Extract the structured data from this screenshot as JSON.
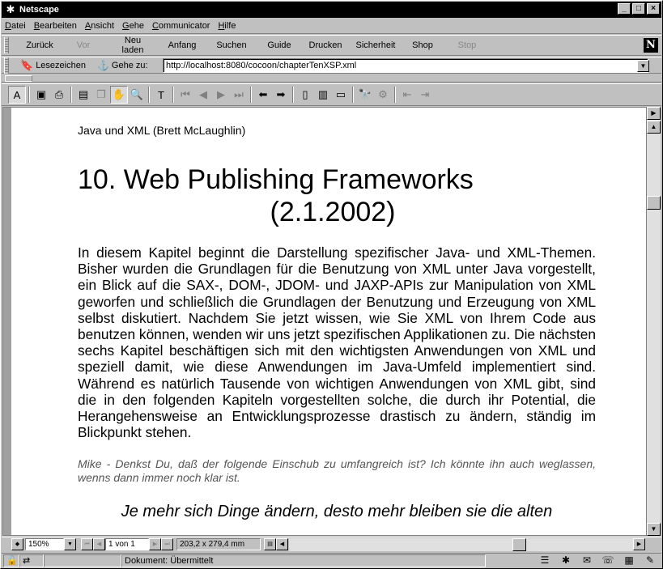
{
  "window": {
    "title": "Netscape"
  },
  "menu": [
    "Datei",
    "Bearbeiten",
    "Ansicht",
    "Gehe",
    "Communicator",
    "Hilfe"
  ],
  "nav": {
    "back": "Zurück",
    "forward": "Vor",
    "reload": "Neu laden",
    "home": "Anfang",
    "search": "Suchen",
    "guide": "Guide",
    "print": "Drucken",
    "security": "Sicherheit",
    "shop": "Shop",
    "stop": "Stop"
  },
  "location": {
    "bookmarks_label": "Lesezeichen",
    "goto_label": "Gehe zu:",
    "url": "http://localhost:8080/cocoon/chapterTenXSP.xml"
  },
  "document": {
    "header": "Java und XML (Brett McLaughlin)",
    "title_line1": "10. Web Publishing Frameworks",
    "title_line2": "(2.1.2002)",
    "body": "In diesem Kapitel beginnt die Darstellung spezifischer Java- und XML-Themen. Bisher wurden die Grundlagen für die Benutzung von XML unter Java vorgestellt, ein Blick auf die SAX-, DOM-, JDOM- und JAXP-APIs zur Manipulation von XML geworfen und schließlich die Grundlagen der Benutzung und Erzeugung von XML selbst diskutiert. Nachdem Sie jetzt wissen, wie Sie XML von Ihrem Code aus benutzen können, wenden wir uns jetzt spezifischen Applikationen zu. Die nächsten sechs Kapitel beschäftigen sich mit den wichtigsten Anwendungen von XML und speziell damit, wie diese Anwendungen im Java-Umfeld implementiert sind. Während es natürlich Tausende von wichtigen Anwendungen von XML gibt, sind die in den folgenden Kapiteln vorgestellten solche, die durch ihr Potential, die Herangehensweise an Entwicklungsprozesse drastisch zu ändern, ständig im Blickpunkt stehen.",
    "note": "Mike - Denkst Du, daß der folgende Einschub zu umfangreich ist? Ich könnte ihn auch weglassen, wenns dann immer noch klar ist.",
    "quote": "Je mehr sich Dinge ändern, desto mehr bleiben sie die alten"
  },
  "viewer": {
    "zoom": "150%",
    "page": "1 von 1",
    "page_size": "203,2 x 279,4 mm"
  },
  "status": {
    "text": "Dokument: Übermittelt"
  }
}
